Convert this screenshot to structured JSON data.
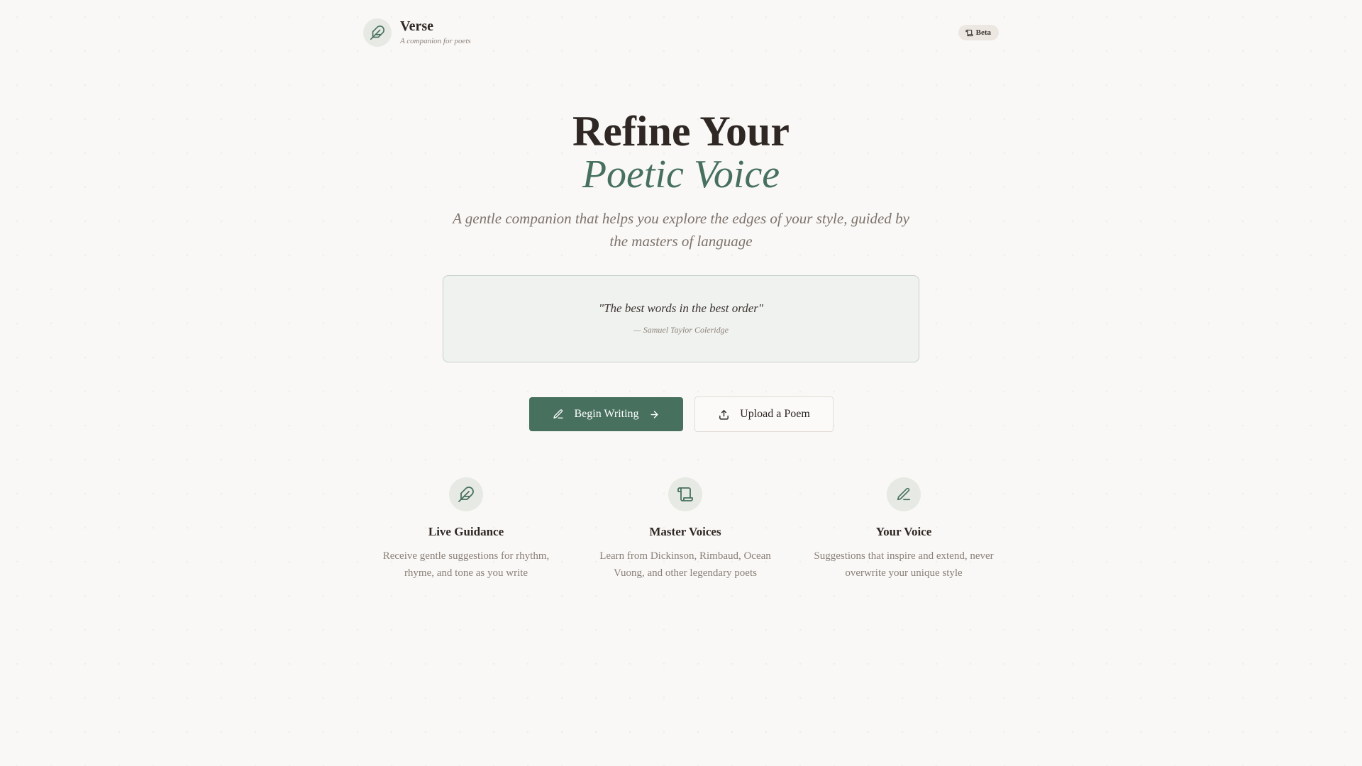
{
  "header": {
    "brand_name": "Verse",
    "brand_tagline": "A companion for poets",
    "logo_icon": "feather-icon",
    "badge": {
      "label": "Beta",
      "icon": "scroll-icon"
    }
  },
  "hero": {
    "title_line1": "Refine Your",
    "title_line2": "Poetic Voice",
    "subtitle": "A gentle companion that helps you explore the edges of your style, guided by the masters of language"
  },
  "quote": {
    "text": "\"The best words in the best order\"",
    "author": "— Samuel Taylor Coleridge"
  },
  "actions": {
    "primary": {
      "label": "Begin Writing",
      "icon": "pencil-icon",
      "trailing_icon": "arrow-right-icon"
    },
    "secondary": {
      "label": "Upload a Poem",
      "icon": "upload-icon"
    }
  },
  "features": [
    {
      "title": "Live Guidance",
      "description": "Receive gentle suggestions for rhythm, rhyme, and tone as you write",
      "icon": "feather-icon"
    },
    {
      "title": "Master Voices",
      "description": "Learn from Dickinson, Rimbaud, Ocean Vuong, and other legendary poets",
      "icon": "scroll-icon"
    },
    {
      "title": "Your Voice",
      "description": "Suggestions that inspire and extend, never overwrite your unique style",
      "icon": "pencil-icon"
    }
  ],
  "colors": {
    "background": "#f9f8f6",
    "accent": "#47705f",
    "text": "#2e2723",
    "muted": "#8a7f78",
    "icon_circle": "#e7e9e4"
  }
}
